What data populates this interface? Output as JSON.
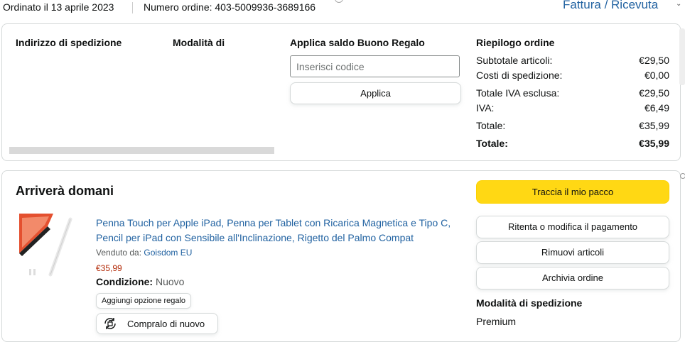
{
  "header": {
    "order_date": "Ordinato il 13 aprile 2023",
    "order_number": "Numero ordine: 403-5009936-3689166",
    "invoice_link": "Fattura / Ricevuta",
    "invoice_chevron": "⌄"
  },
  "summary_box": {
    "shipping_address_label": "Indirizzo di spedizione",
    "payment_method_label": "Modalità di",
    "gift_card_label": "Applica saldo Buono Regalo",
    "gift_code_placeholder": "Inserisci codice",
    "apply_button": "Applica",
    "order_summary_label": "Riepilogo ordine",
    "rows": [
      {
        "label": "Subtotale articoli:",
        "value": "€29,50"
      },
      {
        "label": "Costi di spedizione:",
        "value": "€0,00"
      },
      {
        "label": "Totale IVA esclusa:",
        "value": "€29,50"
      },
      {
        "label": "IVA:",
        "value": "€6,49"
      },
      {
        "label": "Totale:",
        "value": "€35,99"
      },
      {
        "label": "Totale:",
        "value": "€35,99"
      }
    ]
  },
  "shipment": {
    "status": "Arriverà domani",
    "track_button": "Traccia il mio pacco",
    "retry_payment_button": "Ritenta o modifica il pagamento",
    "remove_items_button": "Rimuovi articoli",
    "archive_button": "Archivia ordine",
    "shipping_mode_label": "Modalità di spedizione",
    "shipping_mode_value": "Premium",
    "product": {
      "title": "Penna Touch per Apple iPad, Penna per Tablet con Ricarica Magnetica e Tipo C, Pencil per iPad con Sensibile all'Inclinazione, Rigetto del Palmo Compat",
      "sold_by_label": "Venduto da:",
      "seller": "Goisdom EU",
      "price": "€35,99",
      "condition_label": "Condizione:",
      "condition_value": "Nuovo",
      "gift_option_button": "Aggiungi opzione regalo",
      "buy_again_button": "Compralo di nuovo"
    }
  },
  "colors": {
    "link": "#2162A1",
    "price": "#B12704",
    "track_button_bg": "#FFD814",
    "border": "#D5D9D9"
  }
}
